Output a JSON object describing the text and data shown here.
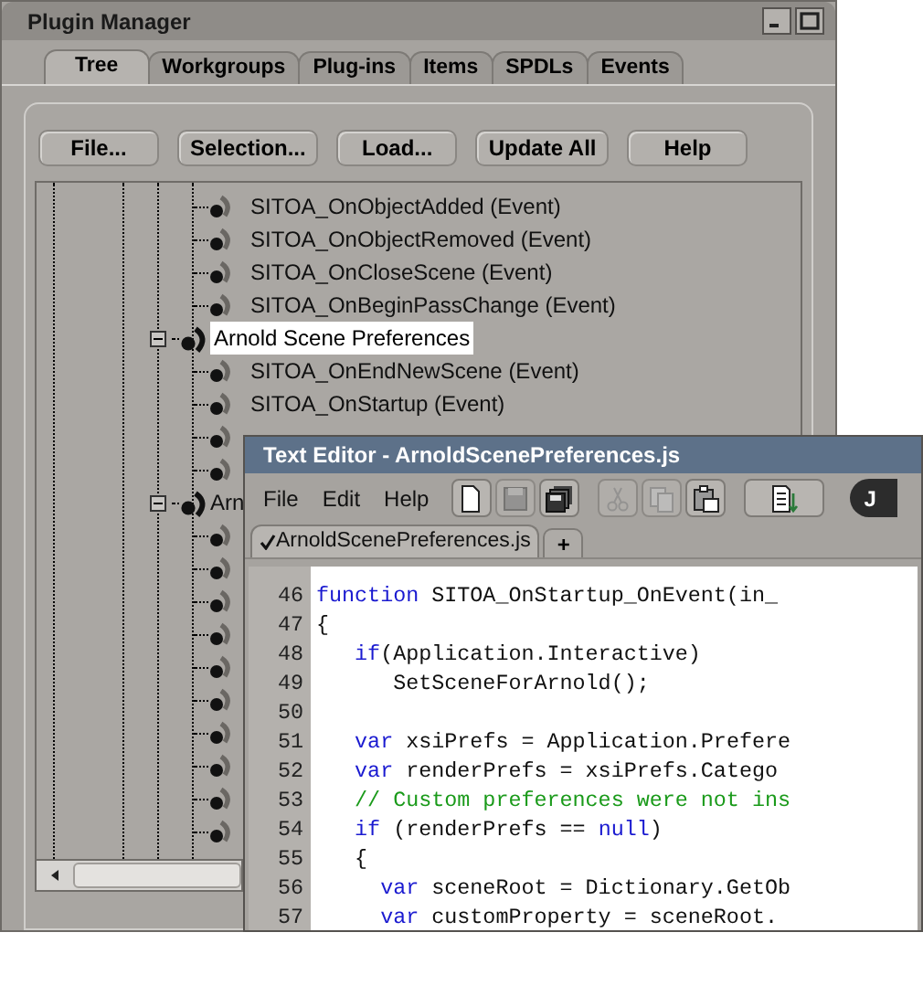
{
  "plugin_manager": {
    "title": "Plugin Manager",
    "tabs": [
      {
        "label": "Tree",
        "selected": true
      },
      {
        "label": "Workgroups",
        "selected": false
      },
      {
        "label": "Plug-ins",
        "selected": false
      },
      {
        "label": "Items",
        "selected": false
      },
      {
        "label": "SPDLs",
        "selected": false
      },
      {
        "label": "Events",
        "selected": false
      }
    ],
    "buttons": [
      "File...",
      "Selection...",
      "Load...",
      "Update All",
      "Help"
    ],
    "tree": {
      "items": [
        {
          "children": [
            {
              "kind": "event",
              "label": "SITOA_OnObjectAdded (Event)"
            },
            {
              "kind": "event",
              "label": "SITOA_OnObjectRemoved (Event)"
            },
            {
              "kind": "event",
              "label": "SITOA_OnCloseScene (Event)"
            },
            {
              "kind": "event",
              "label": "SITOA_OnBeginPassChange (Event)"
            }
          ]
        },
        {
          "kind": "plugin",
          "label": "Arnold Scene Preferences",
          "expanded": true,
          "selected": true,
          "children": [
            {
              "kind": "event",
              "label": "SITOA_OnEndNewScene (Event)"
            },
            {
              "kind": "event",
              "label": "SITOA_OnStartup (Event)"
            },
            {
              "kind": "event"
            },
            {
              "kind": "event"
            }
          ]
        },
        {
          "kind": "plugin",
          "label": "Arn",
          "expanded": true,
          "selected": false,
          "children": [
            {
              "kind": "event"
            },
            {
              "kind": "event"
            },
            {
              "kind": "event"
            },
            {
              "kind": "event"
            },
            {
              "kind": "event"
            },
            {
              "kind": "event"
            },
            {
              "kind": "event"
            },
            {
              "kind": "event"
            },
            {
              "kind": "event"
            },
            {
              "kind": "event"
            }
          ]
        }
      ]
    }
  },
  "text_editor": {
    "title": "Text Editor - ArnoldScenePreferences.js",
    "menu": [
      "File",
      "Edit",
      "Help"
    ],
    "toolbar": [
      {
        "kind": "new",
        "disabled": false
      },
      {
        "kind": "save",
        "disabled": true
      },
      {
        "kind": "save-all",
        "disabled": false
      },
      {
        "kind": "cut",
        "disabled": true
      },
      {
        "kind": "copy",
        "disabled": true
      },
      {
        "kind": "paste",
        "disabled": false
      },
      {
        "kind": "insert",
        "disabled": false
      }
    ],
    "language_badge": "J",
    "tabs": [
      {
        "label": "ArnoldScenePreferences.js",
        "selected": true
      }
    ],
    "new_tab": "+",
    "lines": [
      {
        "number": "46",
        "tokens": [
          {
            "kind": "keyword",
            "text": "function"
          },
          {
            "kind": "plain",
            "text": " SITOA_OnStartup_OnEvent(in_"
          }
        ]
      },
      {
        "number": "47",
        "tokens": [
          {
            "kind": "plain",
            "text": "{"
          }
        ]
      },
      {
        "number": "48",
        "tokens": [
          {
            "kind": "keyword",
            "text": "   if"
          },
          {
            "kind": "plain",
            "text": "(Application.Interactive)"
          }
        ]
      },
      {
        "number": "49",
        "tokens": [
          {
            "kind": "plain",
            "text": "      SetSceneForArnold();"
          }
        ]
      },
      {
        "number": "50"
      },
      {
        "number": "51",
        "tokens": [
          {
            "kind": "keyword",
            "text": "   var"
          },
          {
            "kind": "plain",
            "text": " xsiPrefs = Application.Prefere"
          }
        ]
      },
      {
        "number": "52",
        "tokens": [
          {
            "kind": "keyword",
            "text": "   var"
          },
          {
            "kind": "plain",
            "text": " renderPrefs = xsiPrefs.Catego"
          }
        ]
      },
      {
        "number": "53",
        "tokens": [
          {
            "kind": "comment",
            "text": "   // Custom preferences were not ins"
          }
        ]
      },
      {
        "number": "54",
        "tokens": [
          {
            "kind": "keyword",
            "text": "   if"
          },
          {
            "kind": "plain",
            "text": " (renderPrefs == "
          },
          {
            "kind": "keyword",
            "text": "null"
          },
          {
            "kind": "plain",
            "text": ")"
          }
        ]
      },
      {
        "number": "55",
        "tokens": [
          {
            "kind": "plain",
            "text": "   {"
          }
        ]
      },
      {
        "number": "56",
        "tokens": [
          {
            "kind": "keyword",
            "text": "     var"
          },
          {
            "kind": "plain",
            "text": " sceneRoot = Dictionary.GetOb"
          }
        ]
      },
      {
        "number": "57",
        "tokens": [
          {
            "kind": "keyword",
            "text": "     var"
          },
          {
            "kind": "plain",
            "text": " customProperty = sceneRoot."
          }
        ]
      }
    ]
  }
}
